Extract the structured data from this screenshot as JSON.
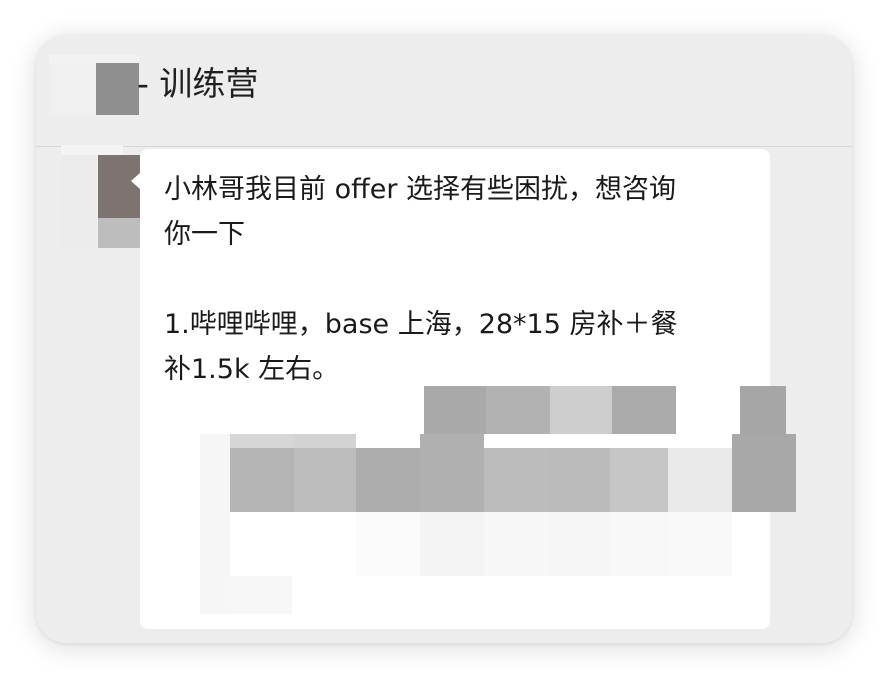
{
  "chat": {
    "title": "- 训练营",
    "title_redacted": true,
    "sender_avatar_redacted": true
  },
  "message": {
    "line1": "小林哥我目前 offer 选择有些困扰，想咨询",
    "line2": "你一下",
    "line3": "1.哔哩哔哩，base 上海，28*15 房补＋餐",
    "line4": "补1.5k 左右。",
    "content_redacted_after": true
  },
  "colors": {
    "window_bg": "#ededed",
    "bubble_bg": "#ffffff",
    "text": "#1a1a1a",
    "divider": "#d6d6d6"
  }
}
